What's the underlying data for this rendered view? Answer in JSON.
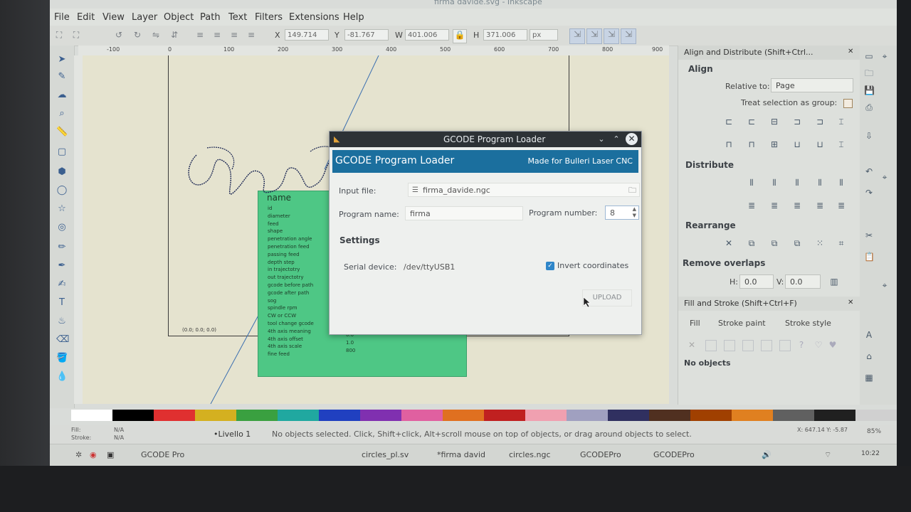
{
  "window": {
    "title": "firma davide.svg - Inkscape"
  },
  "menu": [
    "File",
    "Edit",
    "View",
    "Layer",
    "Object",
    "Path",
    "Text",
    "Filters",
    "Extensions",
    "Help"
  ],
  "toolbar": {
    "x_label": "X",
    "x_value": "149.714",
    "y_label": "Y",
    "y_value": "-81.767",
    "w_label": "W",
    "w_value": "401.006",
    "h_label": "H",
    "h_value": "371.006",
    "unit": "px"
  },
  "ruler_ticks": [
    "-100",
    "0",
    "100",
    "200",
    "300",
    "400",
    "500",
    "600",
    "700",
    "800",
    "900"
  ],
  "canvas": {
    "origin_label": "(0.0; 0.0; 0.0)",
    "green_title": "name",
    "green_params": [
      "id",
      "diameter",
      "feed",
      "shape",
      "penetration angle",
      "penetration feed",
      "passing feed",
      "depth step",
      "in trajectotry",
      "out trajectotry",
      "gcode before path",
      "gcode after path",
      "sog",
      "spindle rpm",
      "CW or CCW",
      "tool change gcode",
      "4th axis meaning",
      "4th axis offset",
      "4th axis scale",
      "fine feed"
    ],
    "green_values": [
      "0.0",
      "1.0",
      "800"
    ]
  },
  "dialog": {
    "window_title": "GCODE Program Loader",
    "header_title": "GCODE Program Loader",
    "header_sub": "Made for Bulleri Laser CNC",
    "input_file_label": "Input file:",
    "input_file_value": "firma_davide.ngc",
    "program_name_label": "Program name:",
    "program_name_value": "firma",
    "program_number_label": "Program number:",
    "program_number_value": "8",
    "settings_label": "Settings",
    "serial_label": "Serial device:",
    "serial_value": "/dev/ttyUSB1",
    "invert_label": "Invert coordinates",
    "invert_checked": true,
    "upload_label": "UPLOAD"
  },
  "align_panel": {
    "title": "Align and Distribute (Shift+Ctrl...",
    "align_label": "Align",
    "relative_label": "Relative to:",
    "relative_value": "Page",
    "treat_label": "Treat selection as group:",
    "distribute_label": "Distribute",
    "rearrange_label": "Rearrange",
    "overlaps_label": "Remove overlaps",
    "h_label": "H:",
    "h_value": "0.0",
    "v_label": "V:",
    "v_value": "0.0"
  },
  "fill_panel": {
    "title": "Fill and Stroke (Shift+Ctrl+F)",
    "tabs": [
      "Fill",
      "Stroke paint",
      "Stroke style"
    ],
    "no_objects": "No objects"
  },
  "status": {
    "fill_label": "Fill:",
    "fill_value": "N/A",
    "stroke_label": "Stroke:",
    "stroke_value": "N/A",
    "layer": "•Livello 1",
    "message": "No objects selected. Click, Shift+click, Alt+scroll mouse on top of objects, or drag around objects to select.",
    "coords": "X: 647.14  Y: -5.87",
    "zoom": "85%"
  },
  "taskbar": {
    "items": [
      "GCODE Pro",
      "circles_pl.sv",
      "*firma david",
      "circles.ngc",
      "GCODEPro",
      "GCODEPro"
    ],
    "clock": "10:22"
  },
  "palette_colors": [
    "#ffffff",
    "#000000",
    "#e03030",
    "#d4b020",
    "#3aa040",
    "#20a8a0",
    "#2040c0",
    "#8030b0",
    "#e060a0",
    "#e07020",
    "#c02020",
    "#f0a0b0",
    "#a0a0c0",
    "#303060",
    "#503020",
    "#a04000",
    "#e08020",
    "#606060",
    "#202020",
    "#d0d0d0"
  ]
}
